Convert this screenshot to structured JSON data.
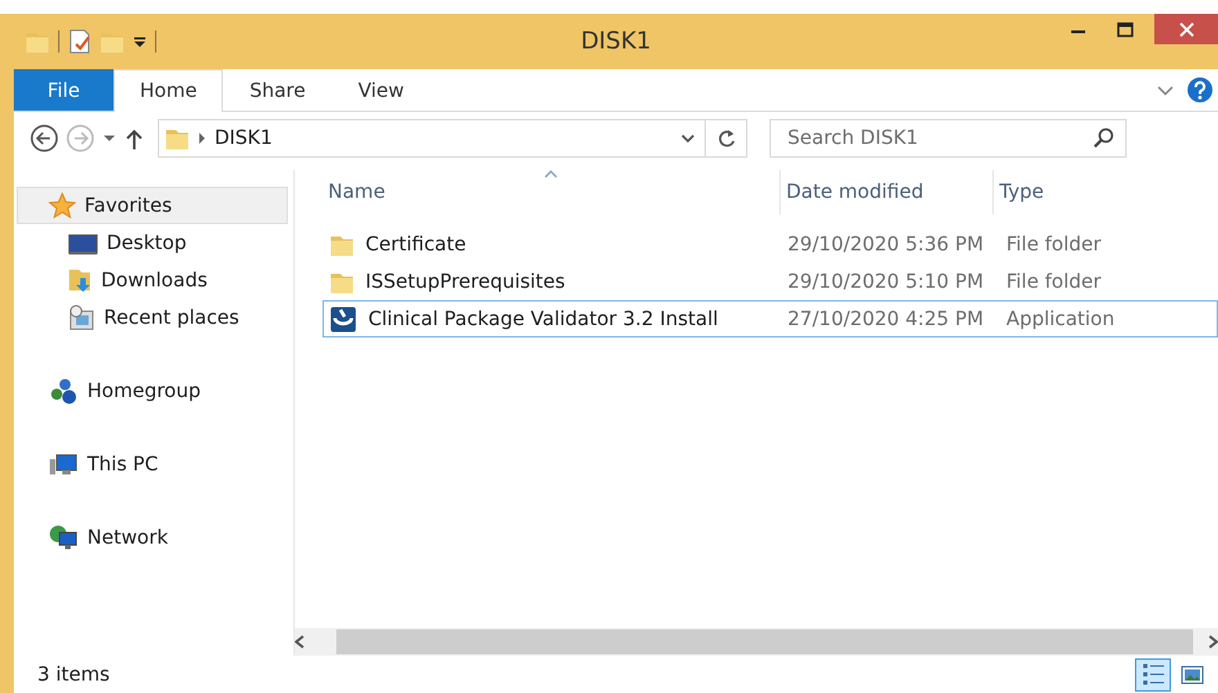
{
  "window": {
    "title": "DISK1"
  },
  "tabs": [
    {
      "label": "File",
      "kind": "file",
      "selected": false
    },
    {
      "label": "Home",
      "kind": "tab",
      "selected": true
    },
    {
      "label": "Share",
      "kind": "tab",
      "selected": false
    },
    {
      "label": "View",
      "kind": "tab",
      "selected": false
    }
  ],
  "address": {
    "path": "DISK1"
  },
  "search": {
    "placeholder": "Search DISK1"
  },
  "sidebar": {
    "items": [
      {
        "label": "Favorites",
        "kind": "star",
        "selected": true,
        "children": [
          {
            "label": "Desktop",
            "kind": "desktop",
            "selected": false
          },
          {
            "label": "Downloads",
            "kind": "downloads",
            "selected": false
          },
          {
            "label": "Recent places",
            "kind": "recent",
            "selected": false
          }
        ]
      },
      {
        "label": "Homegroup",
        "kind": "homegroup",
        "selected": false
      },
      {
        "label": "This PC",
        "kind": "pc",
        "selected": false
      },
      {
        "label": "Network",
        "kind": "network",
        "selected": false
      }
    ]
  },
  "table": {
    "columns": [
      {
        "label": "Name",
        "sorted": true
      },
      {
        "label": "Date modified",
        "sorted": false
      },
      {
        "label": "Type",
        "sorted": false
      }
    ],
    "rows": [
      {
        "name": "Certificate",
        "date": "29/10/2020 5:36 PM",
        "type": "File folder",
        "kind": "folder",
        "selected": false
      },
      {
        "name": "ISSetupPrerequisites",
        "date": "29/10/2020 5:10 PM",
        "type": "File folder",
        "kind": "folder",
        "selected": false
      },
      {
        "name": "Clinical Package Validator 3.2 Install",
        "date": "27/10/2020 4:25 PM",
        "type": "Application",
        "kind": "app",
        "selected": true
      }
    ]
  },
  "status_bar": {
    "count": "3 items",
    "views": [
      {
        "kind": "details",
        "selected": true
      },
      {
        "kind": "tiles",
        "selected": false
      }
    ]
  }
}
